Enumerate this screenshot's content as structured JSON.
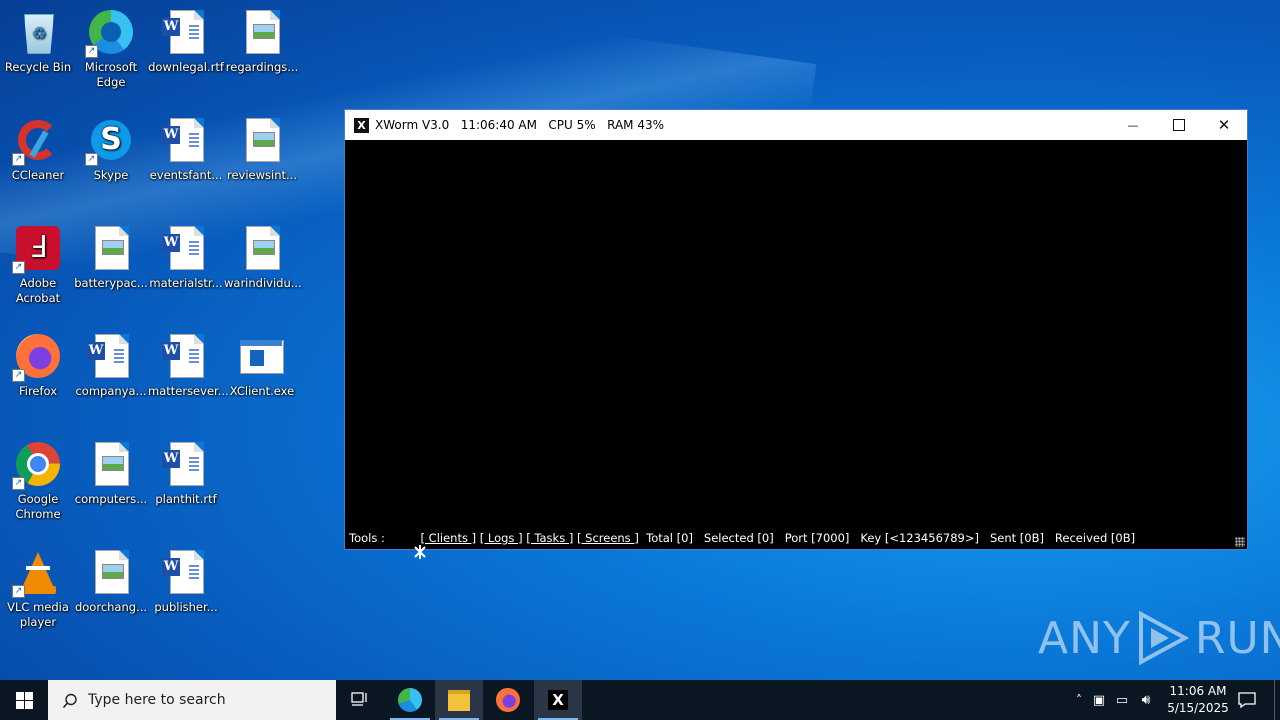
{
  "desktop": {
    "icons": [
      {
        "label": "Recycle Bin",
        "icon": "recycle-bin-icon"
      },
      {
        "label": "Microsoft Edge",
        "icon": "edge-icon"
      },
      {
        "label": "downlegal.rtf",
        "icon": "word-doc-icon"
      },
      {
        "label": "regardings...",
        "icon": "image-file-icon"
      },
      {
        "label": "CCleaner",
        "icon": "ccleaner-icon"
      },
      {
        "label": "Skype",
        "icon": "skype-icon"
      },
      {
        "label": "eventsfant...",
        "icon": "word-doc-icon"
      },
      {
        "label": "reviewsint...",
        "icon": "image-file-icon"
      },
      {
        "label": "Adobe Acrobat",
        "icon": "acrobat-icon"
      },
      {
        "label": "batterypac...",
        "icon": "image-file-icon"
      },
      {
        "label": "materialstr...",
        "icon": "word-doc-icon"
      },
      {
        "label": "warindividu...",
        "icon": "image-file-icon"
      },
      {
        "label": "Firefox",
        "icon": "firefox-icon"
      },
      {
        "label": "companya...",
        "icon": "word-doc-icon"
      },
      {
        "label": "mattersever...",
        "icon": "word-doc-icon"
      },
      {
        "label": "XClient.exe",
        "icon": "exe-icon"
      },
      {
        "label": "Google Chrome",
        "icon": "chrome-icon"
      },
      {
        "label": "computers...",
        "icon": "image-file-icon"
      },
      {
        "label": "planthit.rtf",
        "icon": "word-doc-icon"
      },
      {
        "label": "VLC media player",
        "icon": "vlc-icon"
      },
      {
        "label": "doorchang...",
        "icon": "image-file-icon"
      },
      {
        "label": "publisher...",
        "icon": "word-doc-icon"
      }
    ]
  },
  "window": {
    "title": "XWorm V3.0   11:06:40 AM   CPU 5%   RAM 43%",
    "app_icon_letter": "X",
    "minimize": "—",
    "maximize": "☐",
    "close": "✕",
    "status": {
      "tools_label": "Tools : ",
      "clients": "[ Clients ]",
      "logs": "[ Logs ]",
      "tasks": "[ Tasks ]",
      "screens": "[ Screens ]",
      "total": "Total [0]",
      "selected": "Selected [0]",
      "port": "Port [7000]",
      "key": "Key [<123456789>]",
      "sent": "Sent [0B]",
      "received": "Received [0B]"
    }
  },
  "taskbar": {
    "search_placeholder": "Type here to search",
    "time": "11:06 AM",
    "date": "5/15/2025",
    "apps": [
      "task-view-icon",
      "edge-icon",
      "file-explorer-icon",
      "firefox-icon",
      "xworm-icon"
    ]
  },
  "watermark": {
    "text_left": "ANY",
    "text_right": "RUN"
  }
}
